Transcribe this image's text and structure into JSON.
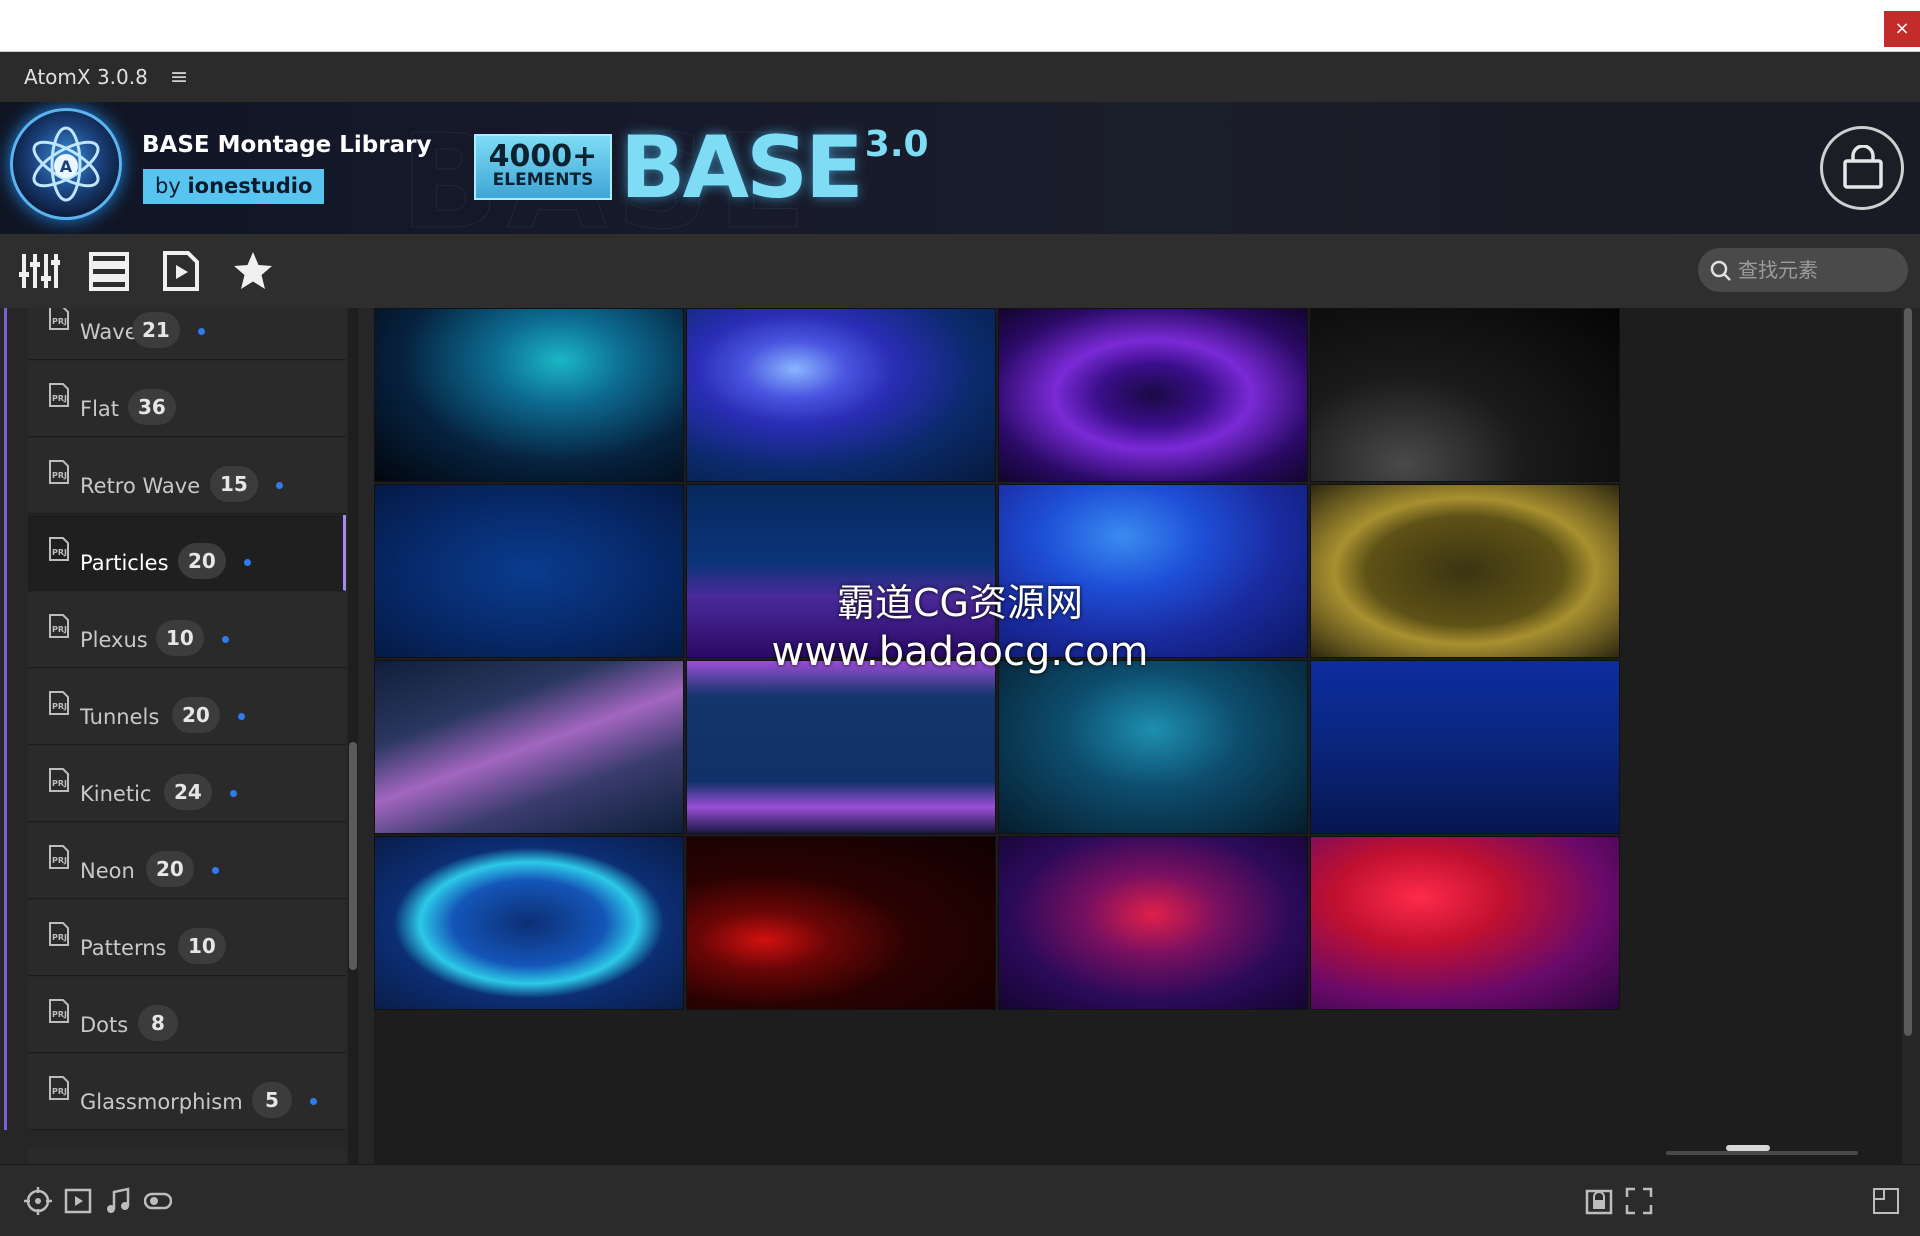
{
  "window": {
    "close_label": "×"
  },
  "app": {
    "title": "AtomX 3.0.8",
    "menu_glyph": "≡"
  },
  "banner": {
    "library_title": "BASE Montage Library",
    "by_prefix": "by ",
    "by_author": "ionestudio",
    "badge_line1": "4000+",
    "badge_line2": "ELEMENTS",
    "brand_word": "BASE",
    "brand_version": "3.0"
  },
  "toolbar": {
    "icons": [
      "sliders-icon",
      "list-icon",
      "media-file-icon",
      "star-icon"
    ],
    "search_placeholder": "查找元素"
  },
  "sidebar": {
    "items": [
      {
        "label": "Waves",
        "count": "21",
        "dot": true
      },
      {
        "label": "Flat",
        "count": "36",
        "dot": false
      },
      {
        "label": "Retro Wave",
        "count": "15",
        "dot": true
      },
      {
        "label": "Particles",
        "count": "20",
        "dot": true,
        "active": true
      },
      {
        "label": "Plexus",
        "count": "10",
        "dot": true
      },
      {
        "label": "Tunnels",
        "count": "20",
        "dot": true
      },
      {
        "label": "Kinetic",
        "count": "24",
        "dot": true
      },
      {
        "label": "Neon",
        "count": "20",
        "dot": true
      },
      {
        "label": "Patterns",
        "count": "10",
        "dot": false
      },
      {
        "label": "Dots",
        "count": "8",
        "dot": false
      },
      {
        "label": "Glassmorphism",
        "count": "5",
        "dot": true
      }
    ]
  },
  "grid": {
    "tiles": [
      {
        "name": "blue-smoke-thumbnail"
      },
      {
        "name": "blue-purple-cloud-thumbnail"
      },
      {
        "name": "purple-burst-thumbnail"
      },
      {
        "name": "white-dust-thumbnail"
      },
      {
        "name": "deep-blue-thumbnail"
      },
      {
        "name": "purple-particle-wave-thumbnail"
      },
      {
        "name": "blue-nebula-thumbnail"
      },
      {
        "name": "gold-ring-thumbnail"
      },
      {
        "name": "pink-waves-thumbnail"
      },
      {
        "name": "purple-bands-thumbnail"
      },
      {
        "name": "teal-dust-thumbnail"
      },
      {
        "name": "blue-rain-thumbnail"
      },
      {
        "name": "cyan-sphere-thumbnail"
      },
      {
        "name": "red-smoke-thumbnail"
      },
      {
        "name": "red-explosion-thumbnail"
      },
      {
        "name": "red-swirl-thumbnail"
      }
    ]
  },
  "watermark": {
    "line1": "霸道CG资源网",
    "line2": "www.badaocg.com"
  },
  "bottombar": {
    "left_icons": [
      "target-icon",
      "play-icon",
      "music-icon",
      "toggle-icon"
    ],
    "right_icons": [
      "lock-icon",
      "fit-icon",
      "expand-icon"
    ]
  },
  "colors": {
    "accent": "#7b5fd0",
    "active_border": "#a58af2",
    "dot": "#2f7bf0",
    "badge": "#58c4f0"
  }
}
